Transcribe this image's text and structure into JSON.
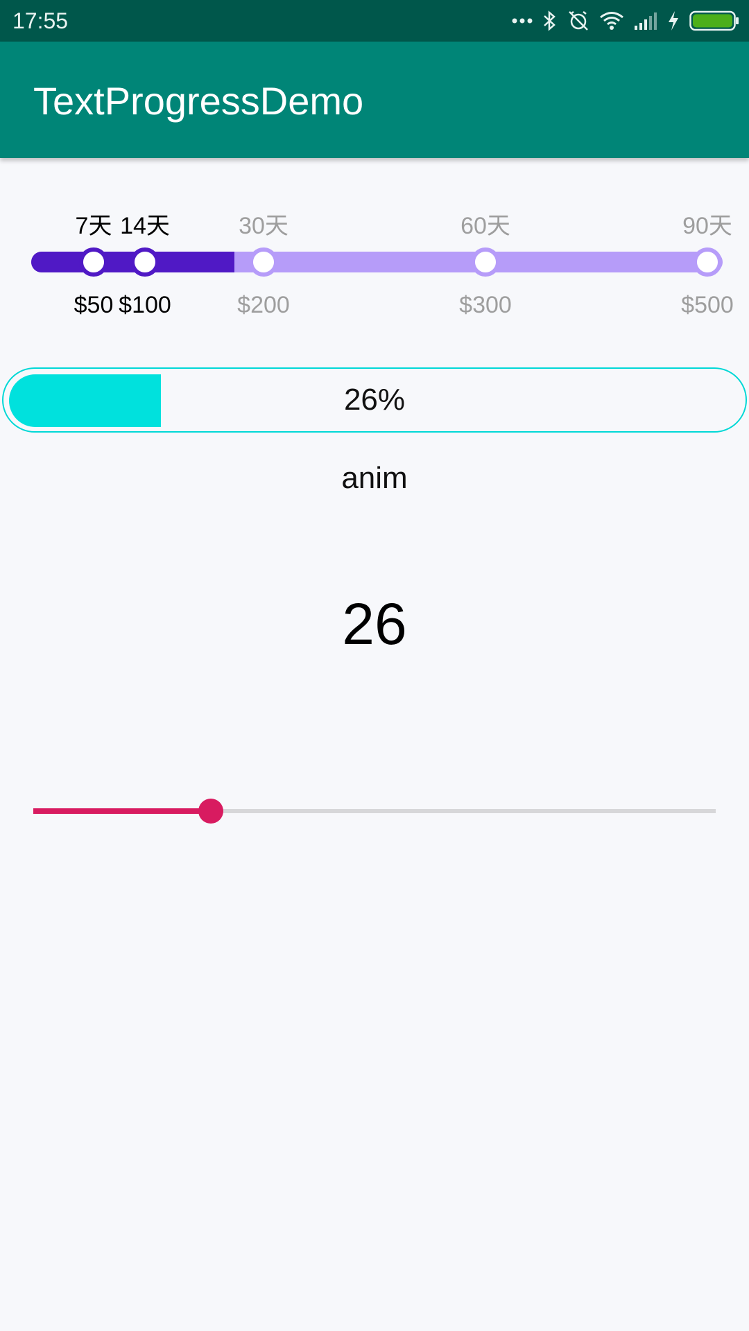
{
  "status_bar": {
    "time": "17:55",
    "icons": [
      "more-dots-icon",
      "bluetooth-icon",
      "alarm-off-icon",
      "wifi-icon",
      "signal-icon",
      "charging-icon",
      "battery-icon"
    ],
    "battery_color": "#4caf1a"
  },
  "app_bar": {
    "title": "TextProgressDemo",
    "color": "#008577"
  },
  "step_progress": {
    "progress": 0.29,
    "active_color": "#5019c5",
    "inactive_color": "#b69cf9",
    "steps": [
      {
        "top": "7天",
        "bottom": "$50",
        "active": true
      },
      {
        "top": "14天",
        "bottom": "$100",
        "active": true
      },
      {
        "top": "30天",
        "bottom": "$200",
        "active": false
      },
      {
        "top": "60天",
        "bottom": "$300",
        "active": false
      },
      {
        "top": "90天",
        "bottom": "$500",
        "active": false
      }
    ]
  },
  "text_progress": {
    "label": "26%",
    "value": 26,
    "color": "#00e1dd"
  },
  "anim_button": {
    "label": "anim"
  },
  "value_display": {
    "text": "26"
  },
  "seekbar": {
    "value": 0.26,
    "color": "#d81b60"
  }
}
